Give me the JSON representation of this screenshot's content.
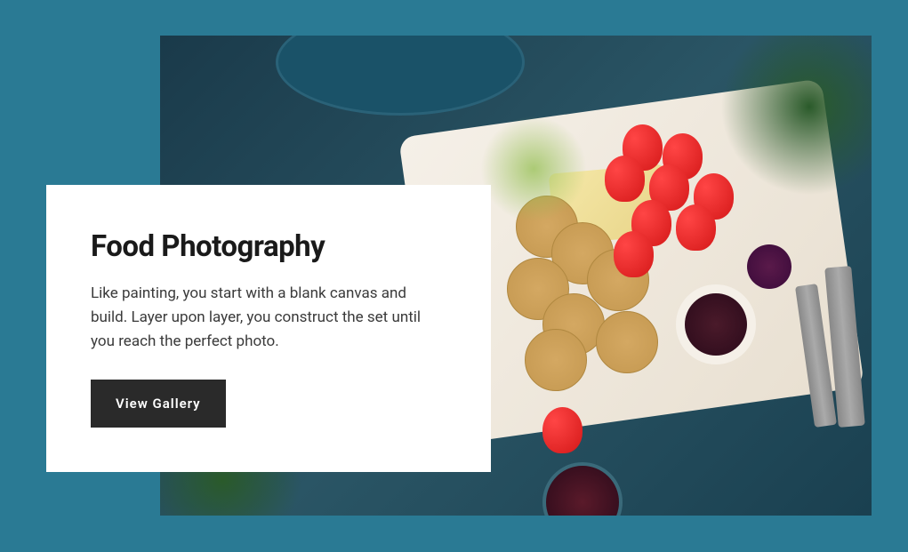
{
  "card": {
    "title": "Food Photography",
    "description": "Like painting, you start with a blank canvas and build. Layer upon layer, you construct the set until you reach the perfect photo.",
    "cta_label": "View Gallery"
  },
  "hero": {
    "alt": "Food photography flat-lay — charcuterie board with crackers, cheese, strawberries, jam, fresh herbs, cutlery and wine on a teal textured surface"
  },
  "colors": {
    "background": "#2a7a94",
    "card_bg": "#ffffff",
    "button_bg": "#2a2a2a",
    "button_text": "#ffffff",
    "title": "#1a1a1a",
    "body_text": "#3a3a3a"
  }
}
